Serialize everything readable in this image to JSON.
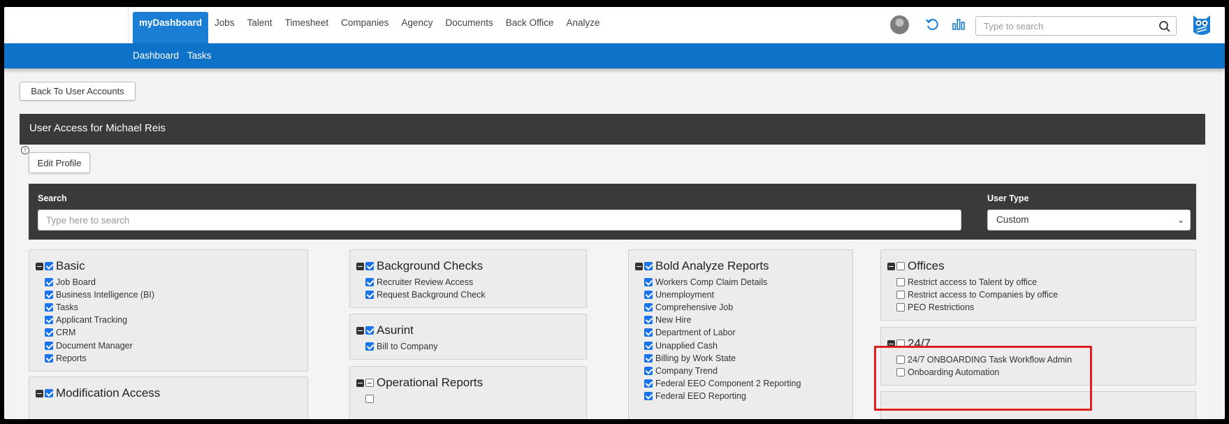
{
  "topnav": {
    "items": [
      "myDashboard",
      "Jobs",
      "Talent",
      "Timesheet",
      "Companies",
      "Agency",
      "Documents",
      "Back Office",
      "Analyze"
    ],
    "active_index": 0,
    "search_placeholder": "Type to search"
  },
  "subnav": {
    "items": [
      "Dashboard",
      "Tasks"
    ]
  },
  "back_button": "Back To User Accounts",
  "panel": {
    "title": "User Access for Michael Reis",
    "edit_button": "Edit Profile",
    "search_label": "Search",
    "search_placeholder": "Type here to search",
    "user_type_label": "User Type",
    "user_type_value": "Custom"
  },
  "groups": {
    "basic": {
      "title": "Basic",
      "checked": true,
      "items": [
        {
          "label": "Job Board",
          "checked": true
        },
        {
          "label": "Business Intelligence (BI)",
          "checked": true
        },
        {
          "label": "Tasks",
          "checked": true
        },
        {
          "label": "Applicant Tracking",
          "checked": true
        },
        {
          "label": "CRM",
          "checked": true
        },
        {
          "label": "Document Manager",
          "checked": true
        },
        {
          "label": "Reports",
          "checked": true
        }
      ]
    },
    "modification": {
      "title": "Modification Access",
      "checked": true,
      "items": []
    },
    "background": {
      "title": "Background Checks",
      "checked": true,
      "items": [
        {
          "label": "Recruiter Review Access",
          "checked": true
        },
        {
          "label": "Request Background Check",
          "checked": true
        }
      ]
    },
    "asurint": {
      "title": "Asurint",
      "checked": true,
      "items": [
        {
          "label": "Bill to Company",
          "checked": true
        }
      ]
    },
    "operational": {
      "title": "Operational Reports",
      "checked": "indeterminate",
      "items": []
    },
    "bold": {
      "title": "Bold Analyze Reports",
      "checked": true,
      "items": [
        {
          "label": "Workers Comp Claim Details",
          "checked": true
        },
        {
          "label": "Unemployment",
          "checked": true
        },
        {
          "label": "Comprehensive Job",
          "checked": true
        },
        {
          "label": "New Hire",
          "checked": true
        },
        {
          "label": "Department of Labor",
          "checked": true
        },
        {
          "label": "Unapplied Cash",
          "checked": true
        },
        {
          "label": "Billing by Work State",
          "checked": true
        },
        {
          "label": "Company Trend",
          "checked": true
        },
        {
          "label": "Federal EEO Component 2 Reporting",
          "checked": true
        },
        {
          "label": "Federal EEO Reporting",
          "checked": true
        }
      ]
    },
    "offices": {
      "title": "Offices",
      "checked": false,
      "items": [
        {
          "label": "Restrict access to Talent by office",
          "checked": false
        },
        {
          "label": "Restrict access to Companies by office",
          "checked": false
        },
        {
          "label": "PEO Restrictions",
          "checked": false
        }
      ]
    },
    "twentyfour": {
      "title": "24/7",
      "checked": false,
      "items": [
        {
          "label": "24/7 ONBOARDING Task Workflow Admin",
          "checked": false
        },
        {
          "label": "Onboarding Automation",
          "checked": false
        }
      ]
    }
  },
  "colors": {
    "accent": "#1a7ed4",
    "subnav": "#0f72c9",
    "header": "#3a3a3a",
    "highlight": "#e02020"
  }
}
